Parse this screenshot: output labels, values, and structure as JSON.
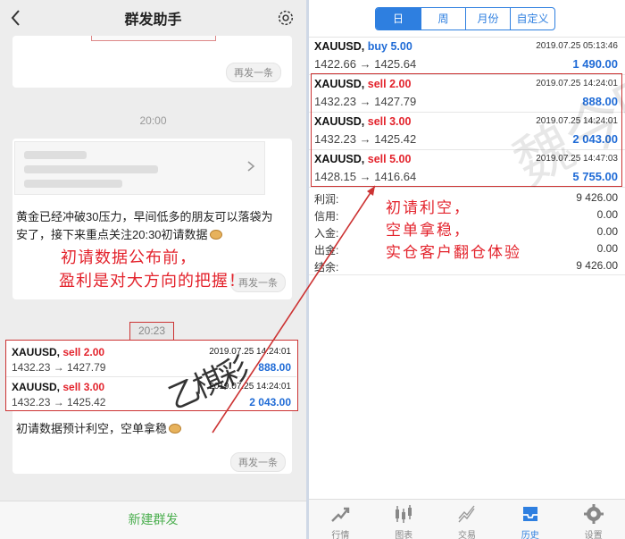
{
  "left": {
    "header": {
      "title": "群发助手"
    },
    "resend_label": "再发一条",
    "time1": "20:00",
    "message": "黄金已经冲破30压力，早间低多的朋友可以落袋为安了，接下来重点关注20:30初请数据",
    "annotation_line1": "初请数据公布前，",
    "annotation_line2": "盈利是对大方向的把握！",
    "time2": "20:23",
    "trades": [
      {
        "symbol": "XAUUSD,",
        "action": "sell 2.00",
        "date": "2019.07.25 14:24:01",
        "prices": "1432.23 → 1427.79",
        "profit": "888.00"
      },
      {
        "symbol": "XAUUSD,",
        "action": "sell 3.00",
        "date": "2019.07.25 14:24:01",
        "prices": "1432.23 → 1425.42",
        "profit": "2 043.00"
      }
    ],
    "message2": "初请数据预计利空，空单拿稳",
    "new_group": "新建群发"
  },
  "right": {
    "tabs": [
      "日",
      "周",
      "月份",
      "自定义"
    ],
    "rows": [
      {
        "symbol": "XAUUSD,",
        "action": "buy 5.00",
        "type": "buy",
        "date": "2019.07.25 05:13:46",
        "prices": "1422.66 → 1425.64",
        "profit": "1 490.00"
      },
      {
        "symbol": "XAUUSD,",
        "action": "sell 2.00",
        "type": "sell",
        "date": "2019.07.25 14:24:01",
        "prices": "1432.23 → 1427.79",
        "profit": "888.00"
      },
      {
        "symbol": "XAUUSD,",
        "action": "sell 3.00",
        "type": "sell",
        "date": "2019.07.25 14:24:01",
        "prices": "1432.23 → 1425.42",
        "profit": "2 043.00"
      },
      {
        "symbol": "XAUUSD,",
        "action": "sell 5.00",
        "type": "sell",
        "date": "2019.07.25 14:47:03",
        "prices": "1428.15 → 1416.64",
        "profit": "5 755.00"
      }
    ],
    "summary": [
      {
        "label": "利润:",
        "value": "9 426.00"
      },
      {
        "label": "信用:",
        "value": "0.00"
      },
      {
        "label": "入金:",
        "value": "0.00"
      },
      {
        "label": "出金:",
        "value": "0.00"
      },
      {
        "label": "结余:",
        "value": "9 426.00"
      }
    ],
    "annotation": [
      "初请利空，",
      "空单拿稳，",
      "实仓客户翻仓体验"
    ],
    "watermark": "魏今团队",
    "tabbar": [
      {
        "label": "行情",
        "icon": "quotes-icon"
      },
      {
        "label": "图表",
        "icon": "chart-icon"
      },
      {
        "label": "交易",
        "icon": "trade-icon"
      },
      {
        "label": "历史",
        "icon": "history-icon",
        "active": true
      },
      {
        "label": "设置",
        "icon": "settings-icon"
      }
    ]
  },
  "colors": {
    "accent": "#2e7fe0",
    "annotation_red": "#e3232c",
    "profit_blue": "#1f6bd6",
    "new_group_green": "#4caf50"
  }
}
